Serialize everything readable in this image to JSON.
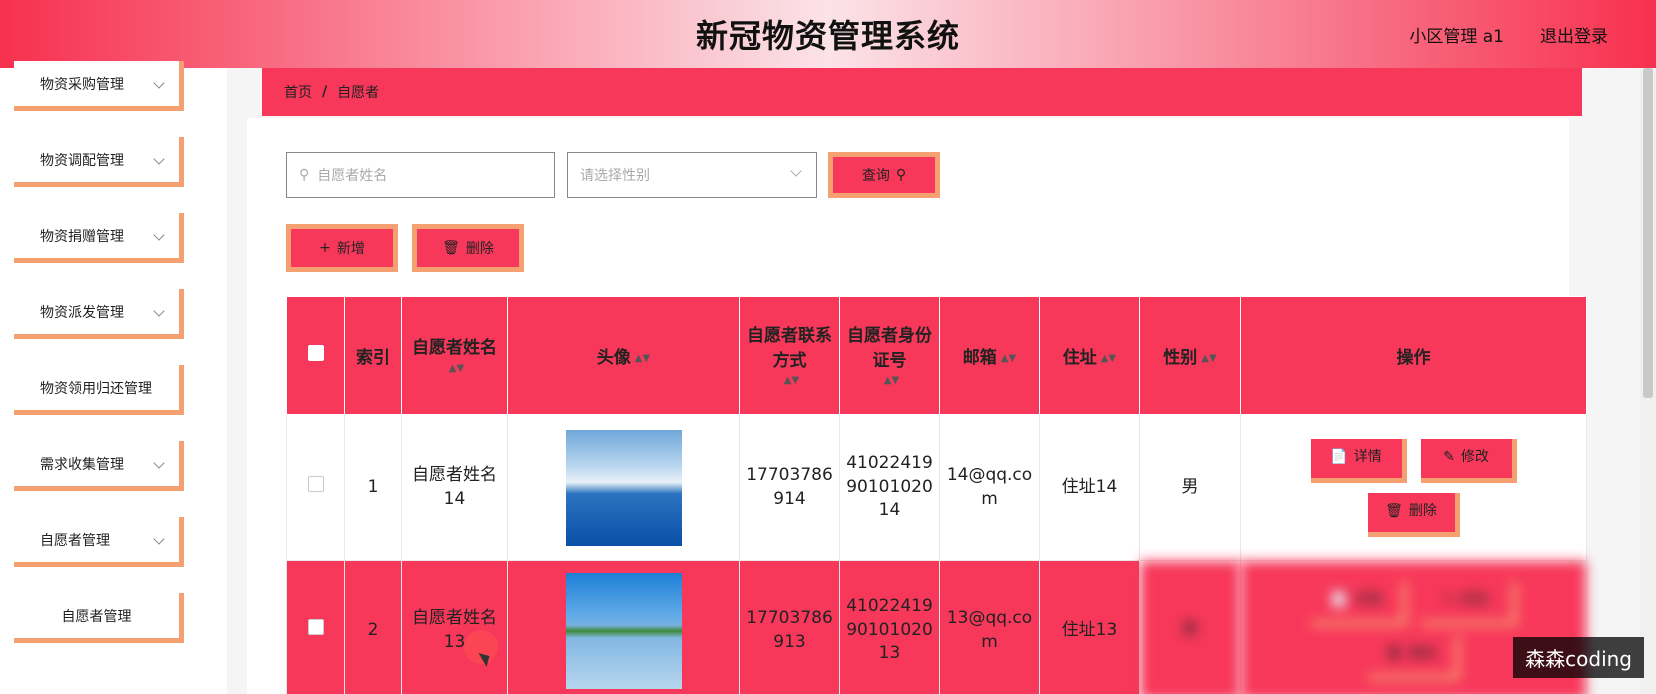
{
  "header": {
    "title": "新冠物资管理系统",
    "user": "小区管理 a1",
    "logout": "退出登录"
  },
  "sidebar": {
    "items": [
      {
        "label": "物资采购管理"
      },
      {
        "label": "物资调配管理"
      },
      {
        "label": "物资捐赠管理"
      },
      {
        "label": "物资派发管理"
      },
      {
        "label": "物资领用归还管理"
      },
      {
        "label": "需求收集管理"
      },
      {
        "label": "自愿者管理"
      },
      {
        "label": "自愿者管理"
      }
    ]
  },
  "breadcrumb": {
    "home": "首页",
    "separator": "/",
    "current": "自愿者"
  },
  "search": {
    "name_placeholder": "自愿者姓名",
    "gender_placeholder": "请选择性别",
    "query_label": "查询"
  },
  "actions": {
    "add_label": "新增",
    "delete_label": "删除"
  },
  "table": {
    "columns": [
      "索引",
      "自愿者姓名",
      "头像",
      "自愿者联系方式",
      "自愿者身份证号",
      "邮箱",
      "住址",
      "性别",
      "操作"
    ],
    "rows": [
      {
        "index": "1",
        "name": "自愿者姓名14",
        "phone": "17703786914",
        "idno": "410224199010102014",
        "email": "14@qq.com",
        "address": "住址14",
        "gender": "男"
      },
      {
        "index": "2",
        "name": "自愿者姓名13",
        "phone": "17703786913",
        "idno": "410224199010102013",
        "email": "13@qq.com",
        "address": "住址13",
        "gender": "男"
      }
    ],
    "row_actions": {
      "detail": "详情",
      "edit": "修改",
      "delete": "删除"
    }
  },
  "watermark": "森森coding"
}
